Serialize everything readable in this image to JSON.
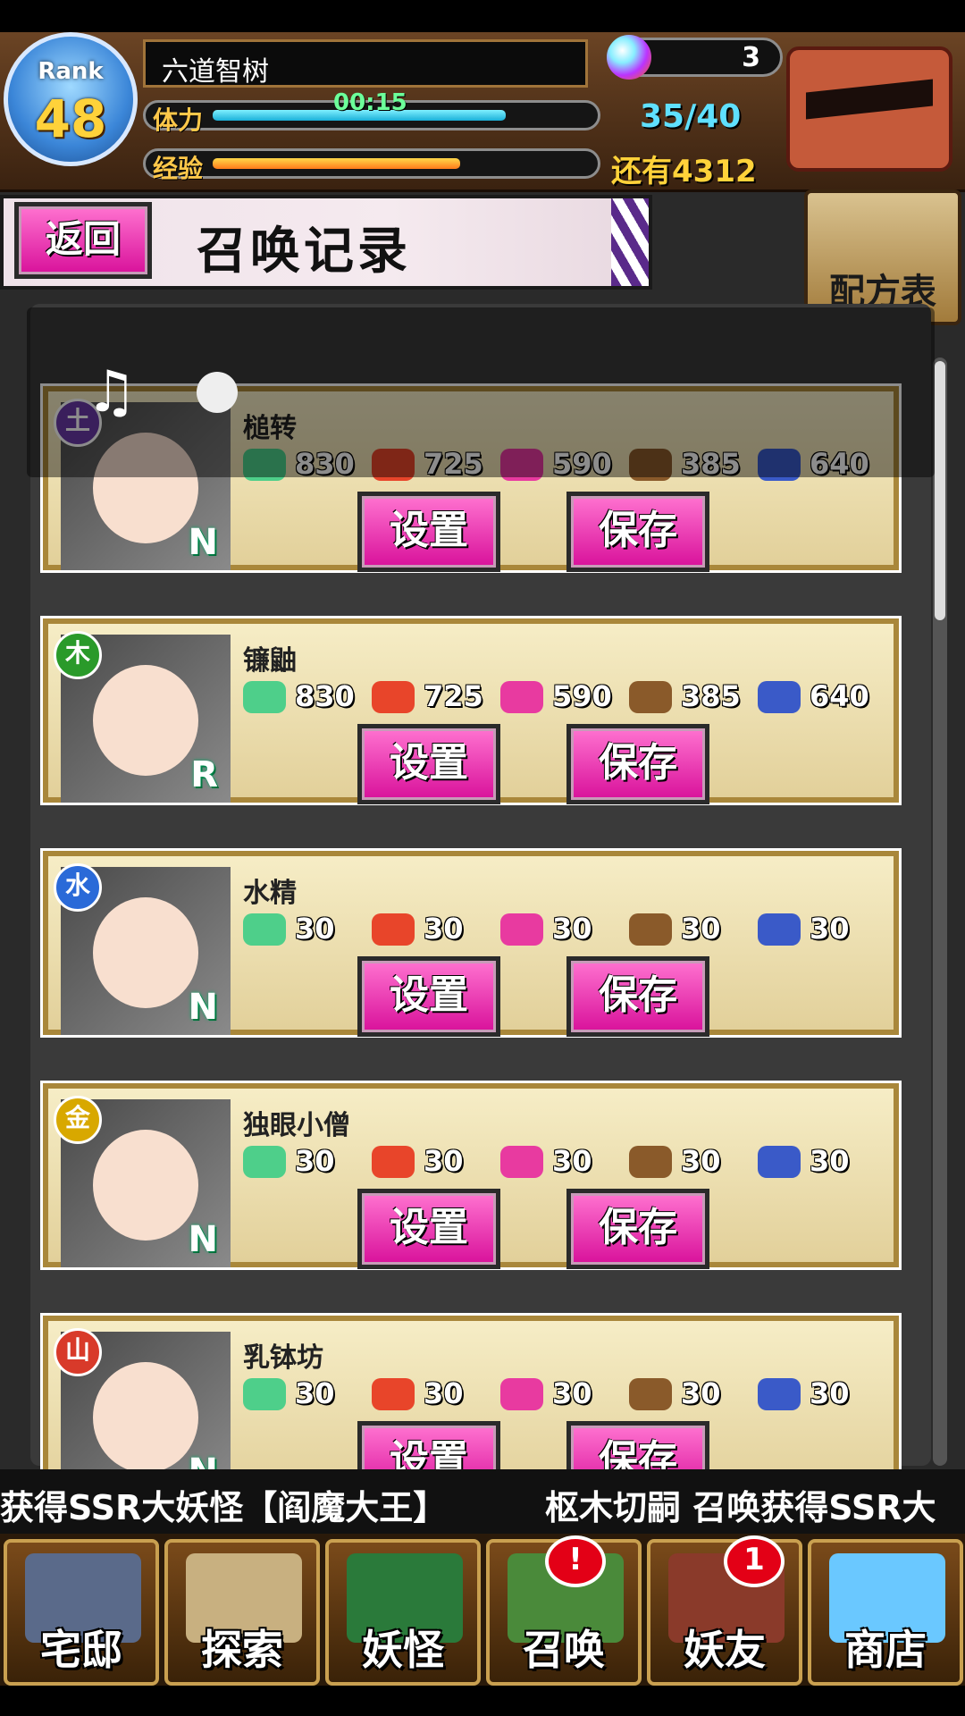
{
  "player": {
    "rank_label": "Rank",
    "rank": "48",
    "name": "六道智树",
    "stamina_label": "体力",
    "exp_label": "经验",
    "timer": "00:15",
    "gems": "3",
    "stamina": "35/40",
    "exp_remaining": "还有4312",
    "stamina_fill": 0.78,
    "exp_fill": 0.66
  },
  "page": {
    "back_label": "返回",
    "title": "召唤记录",
    "recipe_label": "配方表"
  },
  "cards": [
    {
      "name": "槌转",
      "element": "土",
      "rarity": "N",
      "element_color": "#6a3aa8",
      "materials": [
        "830",
        "725",
        "590",
        "385",
        "640"
      ],
      "set_label": "设置",
      "save_label": "保存"
    },
    {
      "name": "镰鼬",
      "element": "木",
      "rarity": "R",
      "element_color": "#2a9a2a",
      "materials": [
        "830",
        "725",
        "590",
        "385",
        "640"
      ],
      "set_label": "设置",
      "save_label": "保存"
    },
    {
      "name": "水精",
      "element": "水",
      "rarity": "N",
      "element_color": "#2a6ad8",
      "materials": [
        "30",
        "30",
        "30",
        "30",
        "30"
      ],
      "set_label": "设置",
      "save_label": "保存"
    },
    {
      "name": "独眼小僧",
      "element": "金",
      "rarity": "N",
      "element_color": "#d8a800",
      "materials": [
        "30",
        "30",
        "30",
        "30",
        "30"
      ],
      "set_label": "设置",
      "save_label": "保存"
    },
    {
      "name": "乳钵坊",
      "element": "山",
      "rarity": "N",
      "element_color": "#d83a2a",
      "materials": [
        "30",
        "30",
        "30",
        "30",
        "30"
      ],
      "set_label": "设置",
      "save_label": "保存"
    }
  ],
  "ticker": {
    "text1": "获得SSR大妖怪【阎魔大王】",
    "text2": "枢木切嗣 召唤获得SSR大"
  },
  "nav": [
    {
      "label": "宅邸",
      "badge": ""
    },
    {
      "label": "探索",
      "badge": ""
    },
    {
      "label": "妖怪",
      "badge": ""
    },
    {
      "label": "召唤",
      "badge": "!"
    },
    {
      "label": "妖友",
      "badge": "1"
    },
    {
      "label": "商店",
      "badge": ""
    }
  ],
  "icons": {
    "rank_badge": "pentagram-badge-icon",
    "gem": "crystal-orb-icon",
    "chest": "treasure-chest-icon",
    "music": "music-note-icon"
  }
}
